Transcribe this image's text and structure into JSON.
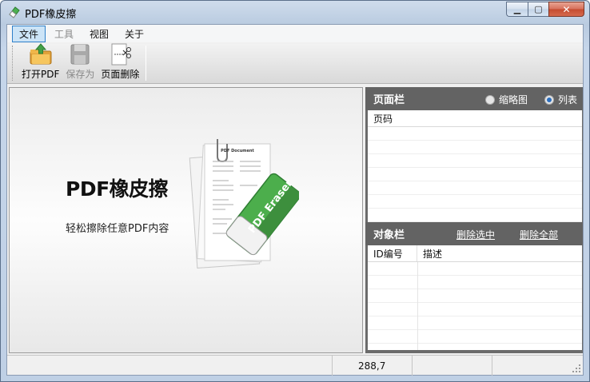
{
  "window": {
    "title": "PDF橡皮擦",
    "minimize_label": "▁",
    "maximize_label": "▢",
    "close_label": "✕"
  },
  "menu": {
    "items": [
      {
        "label": "文件",
        "state": "active"
      },
      {
        "label": "工具",
        "state": "disabled"
      },
      {
        "label": "视图",
        "state": "normal"
      },
      {
        "label": "关于",
        "state": "normal"
      }
    ]
  },
  "toolbar": {
    "open_label": "打开PDF",
    "save_label": "保存为",
    "delete_page_label": "页面删除"
  },
  "hero": {
    "title": "PDF橡皮擦",
    "subtitle": "轻松擦除任意PDF内容",
    "doc_caption": "PDF Document",
    "eraser_text": "PDF Eraser"
  },
  "page_panel": {
    "title": "页面栏",
    "view_thumbnail": "缩略图",
    "view_list": "列表",
    "selected_view": "列表",
    "column_header": "页码"
  },
  "object_panel": {
    "title": "对象栏",
    "delete_selected": "删除选中",
    "delete_all": "删除全部",
    "col_id": "ID编号",
    "col_desc": "描述"
  },
  "status": {
    "coords": "288,7"
  },
  "colors": {
    "accent_green": "#5cb85c",
    "panel_header": "#636363",
    "menu_highlight": "#cce4f7"
  }
}
